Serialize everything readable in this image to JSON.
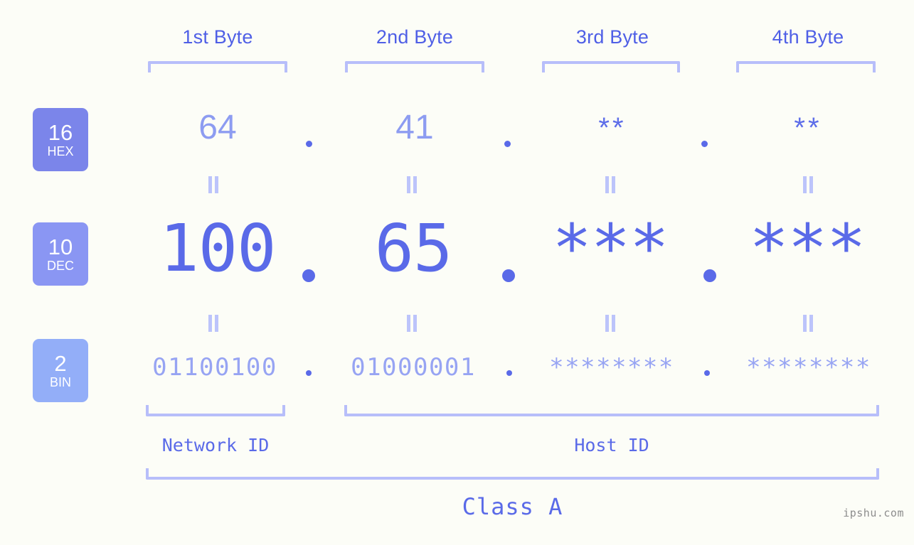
{
  "page": {
    "background_color": "#fcfdf7",
    "accent_color": "#5a6ae8",
    "bracket_color": "#b7befa"
  },
  "header": {
    "byte_columns": [
      {
        "label": "1st Byte"
      },
      {
        "label": "2nd Byte"
      },
      {
        "label": "3rd Byte"
      },
      {
        "label": "4th Byte"
      }
    ]
  },
  "radix_badges": [
    {
      "number": "16",
      "name": "HEX",
      "color": "#7b85ea"
    },
    {
      "number": "10",
      "name": "DEC",
      "color": "#8a96f3"
    },
    {
      "number": "2",
      "name": "BIN",
      "color": "#93aef8"
    }
  ],
  "rows": {
    "hex": {
      "radix": "16",
      "radix_name": "HEX",
      "octets": [
        "64",
        "41",
        "**",
        "**"
      ],
      "separator": "."
    },
    "dec": {
      "radix": "10",
      "radix_name": "DEC",
      "octets": [
        "100",
        "65",
        "***",
        "***"
      ],
      "separator": "."
    },
    "bin": {
      "radix": "2",
      "radix_name": "BIN",
      "octets": [
        "01100100",
        "01000001",
        "********",
        "********"
      ],
      "separator": "."
    }
  },
  "connectors": {
    "equals_glyph": "||"
  },
  "footer": {
    "network_id_label": "Network ID",
    "host_id_label": "Host ID",
    "class_label": "Class A",
    "watermark": "ipshu.com"
  }
}
